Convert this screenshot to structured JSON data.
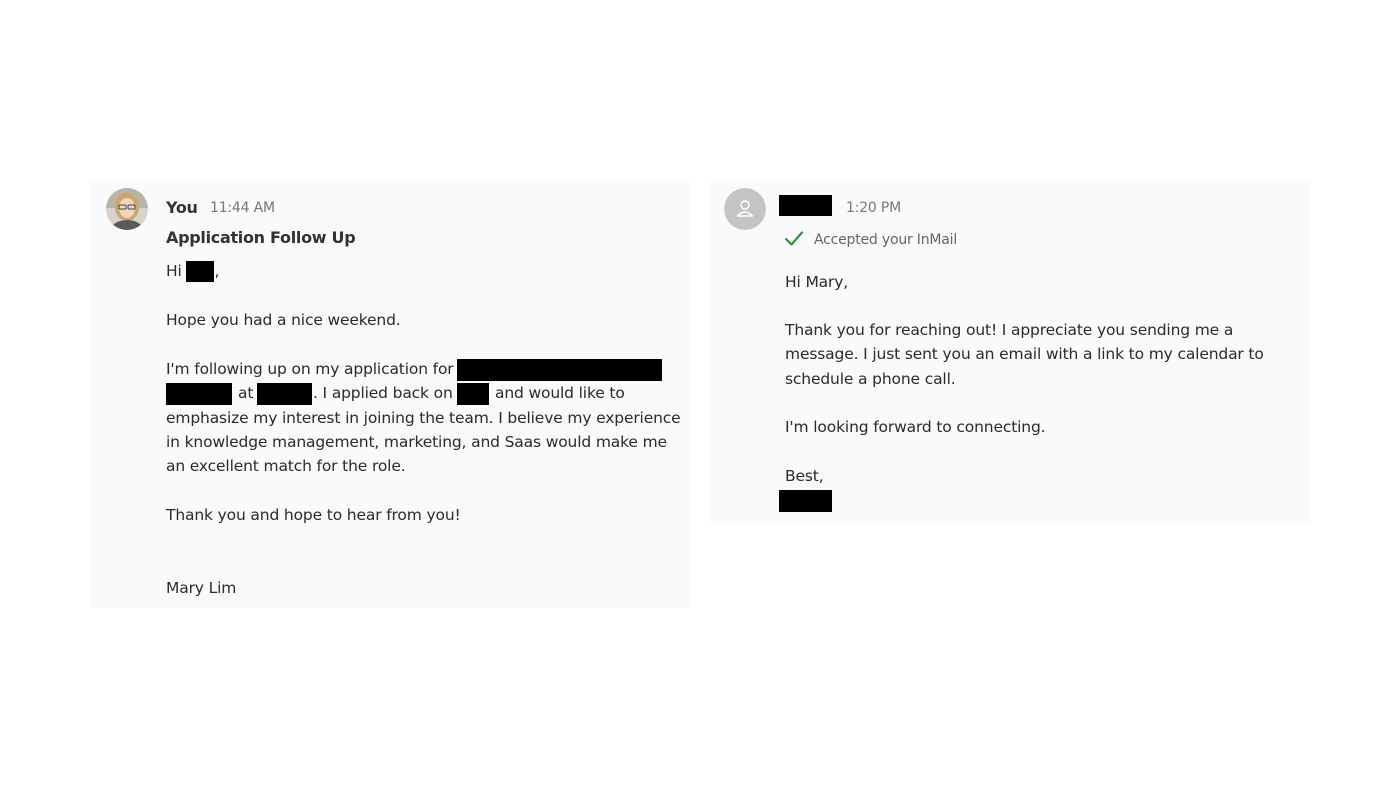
{
  "left_message": {
    "sender": "You",
    "time": "11:44 AM",
    "subject": "Application Follow Up",
    "greeting_prefix": "Hi",
    "greeting_suffix": ",",
    "para1": "Hope you had a nice weekend.",
    "line3_prefix": "I'm following up on my application for",
    "line4_at": "at",
    "line4_applied": ". I applied back on",
    "line4_tail": "and would like to",
    "line5": "emphasize my interest in joining the team. I believe my experience",
    "line6": "in knowledge management, marketing, and Saas would make me",
    "line7": "an excellent match for the role.",
    "para3": "Thank you and hope to hear from you!",
    "signature": "Mary Lim"
  },
  "right_message": {
    "time": "1:20 PM",
    "status": "Accepted your InMail",
    "status_color": "#3d8f3d",
    "greeting": "Hi Mary,",
    "line2": "Thank you for reaching out! I appreciate you sending me a",
    "line3": "message. I just sent you an email with a link to my calendar to",
    "line4": "schedule a phone call.",
    "line5": "I'm looking forward to connecting.",
    "closing": "Best,"
  }
}
